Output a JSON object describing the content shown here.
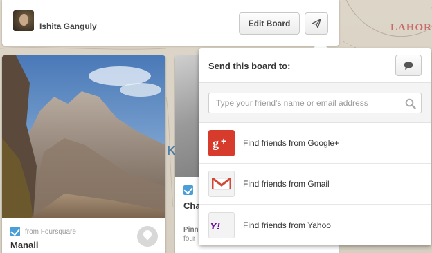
{
  "header": {
    "user_name": "Ishita Ganguly",
    "edit_board_label": "Edit Board"
  },
  "map": {
    "place_label": "LAHOR",
    "partial_label": "K"
  },
  "pins": [
    {
      "source": "from Foursquare",
      "title": "Manali"
    },
    {
      "title": "Cha",
      "footer_line1": "Pinn",
      "footer_line2": "four"
    }
  ],
  "send_popover": {
    "title": "Send this board to:",
    "search_placeholder": "Type your friend's name or email address",
    "search_value": "",
    "options": [
      {
        "label": "Find friends from Google+",
        "icon": "google-plus-icon"
      },
      {
        "label": "Find friends from Gmail",
        "icon": "gmail-icon"
      },
      {
        "label": "Find friends from Yahoo",
        "icon": "yahoo-icon"
      }
    ]
  },
  "colors": {
    "google_plus": "#d63b2b",
    "gmail_red": "#d14836",
    "yahoo_purple": "#720e9e",
    "foursquare_check": "#4a9fd8"
  }
}
